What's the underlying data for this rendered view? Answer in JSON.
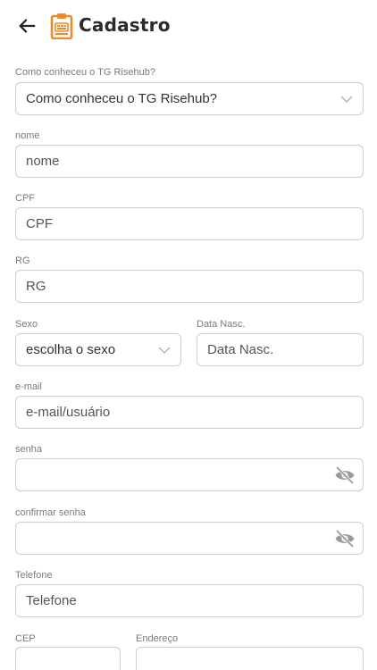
{
  "header": {
    "title": "Cadastro",
    "logo_color": "#ee8a2a"
  },
  "form": {
    "como_conheceu": {
      "label": "Como conheceu o TG Risehub?",
      "value": "Como conheceu o TG Risehub?"
    },
    "nome": {
      "label": "nome",
      "placeholder": "nome"
    },
    "cpf": {
      "label": "CPF",
      "placeholder": "CPF"
    },
    "rg": {
      "label": "RG",
      "placeholder": "RG"
    },
    "sexo": {
      "label": "Sexo",
      "value": "escolha o sexo"
    },
    "data_nasc": {
      "label": "Data Nasc.",
      "placeholder": "Data Nasc."
    },
    "email": {
      "label": "e-mail",
      "placeholder": "e-mail/usuário"
    },
    "senha": {
      "label": "senha",
      "placeholder": ""
    },
    "confirmar_senha": {
      "label": "confirmar senha",
      "placeholder": ""
    },
    "telefone": {
      "label": "Telefone",
      "placeholder": "Telefone"
    },
    "cep": {
      "label": "CEP"
    },
    "endereco": {
      "label": "Endereço"
    }
  },
  "colors": {
    "border": "#cfcfcf",
    "label": "#7a7a7a",
    "icon": "#9a9a9a"
  }
}
